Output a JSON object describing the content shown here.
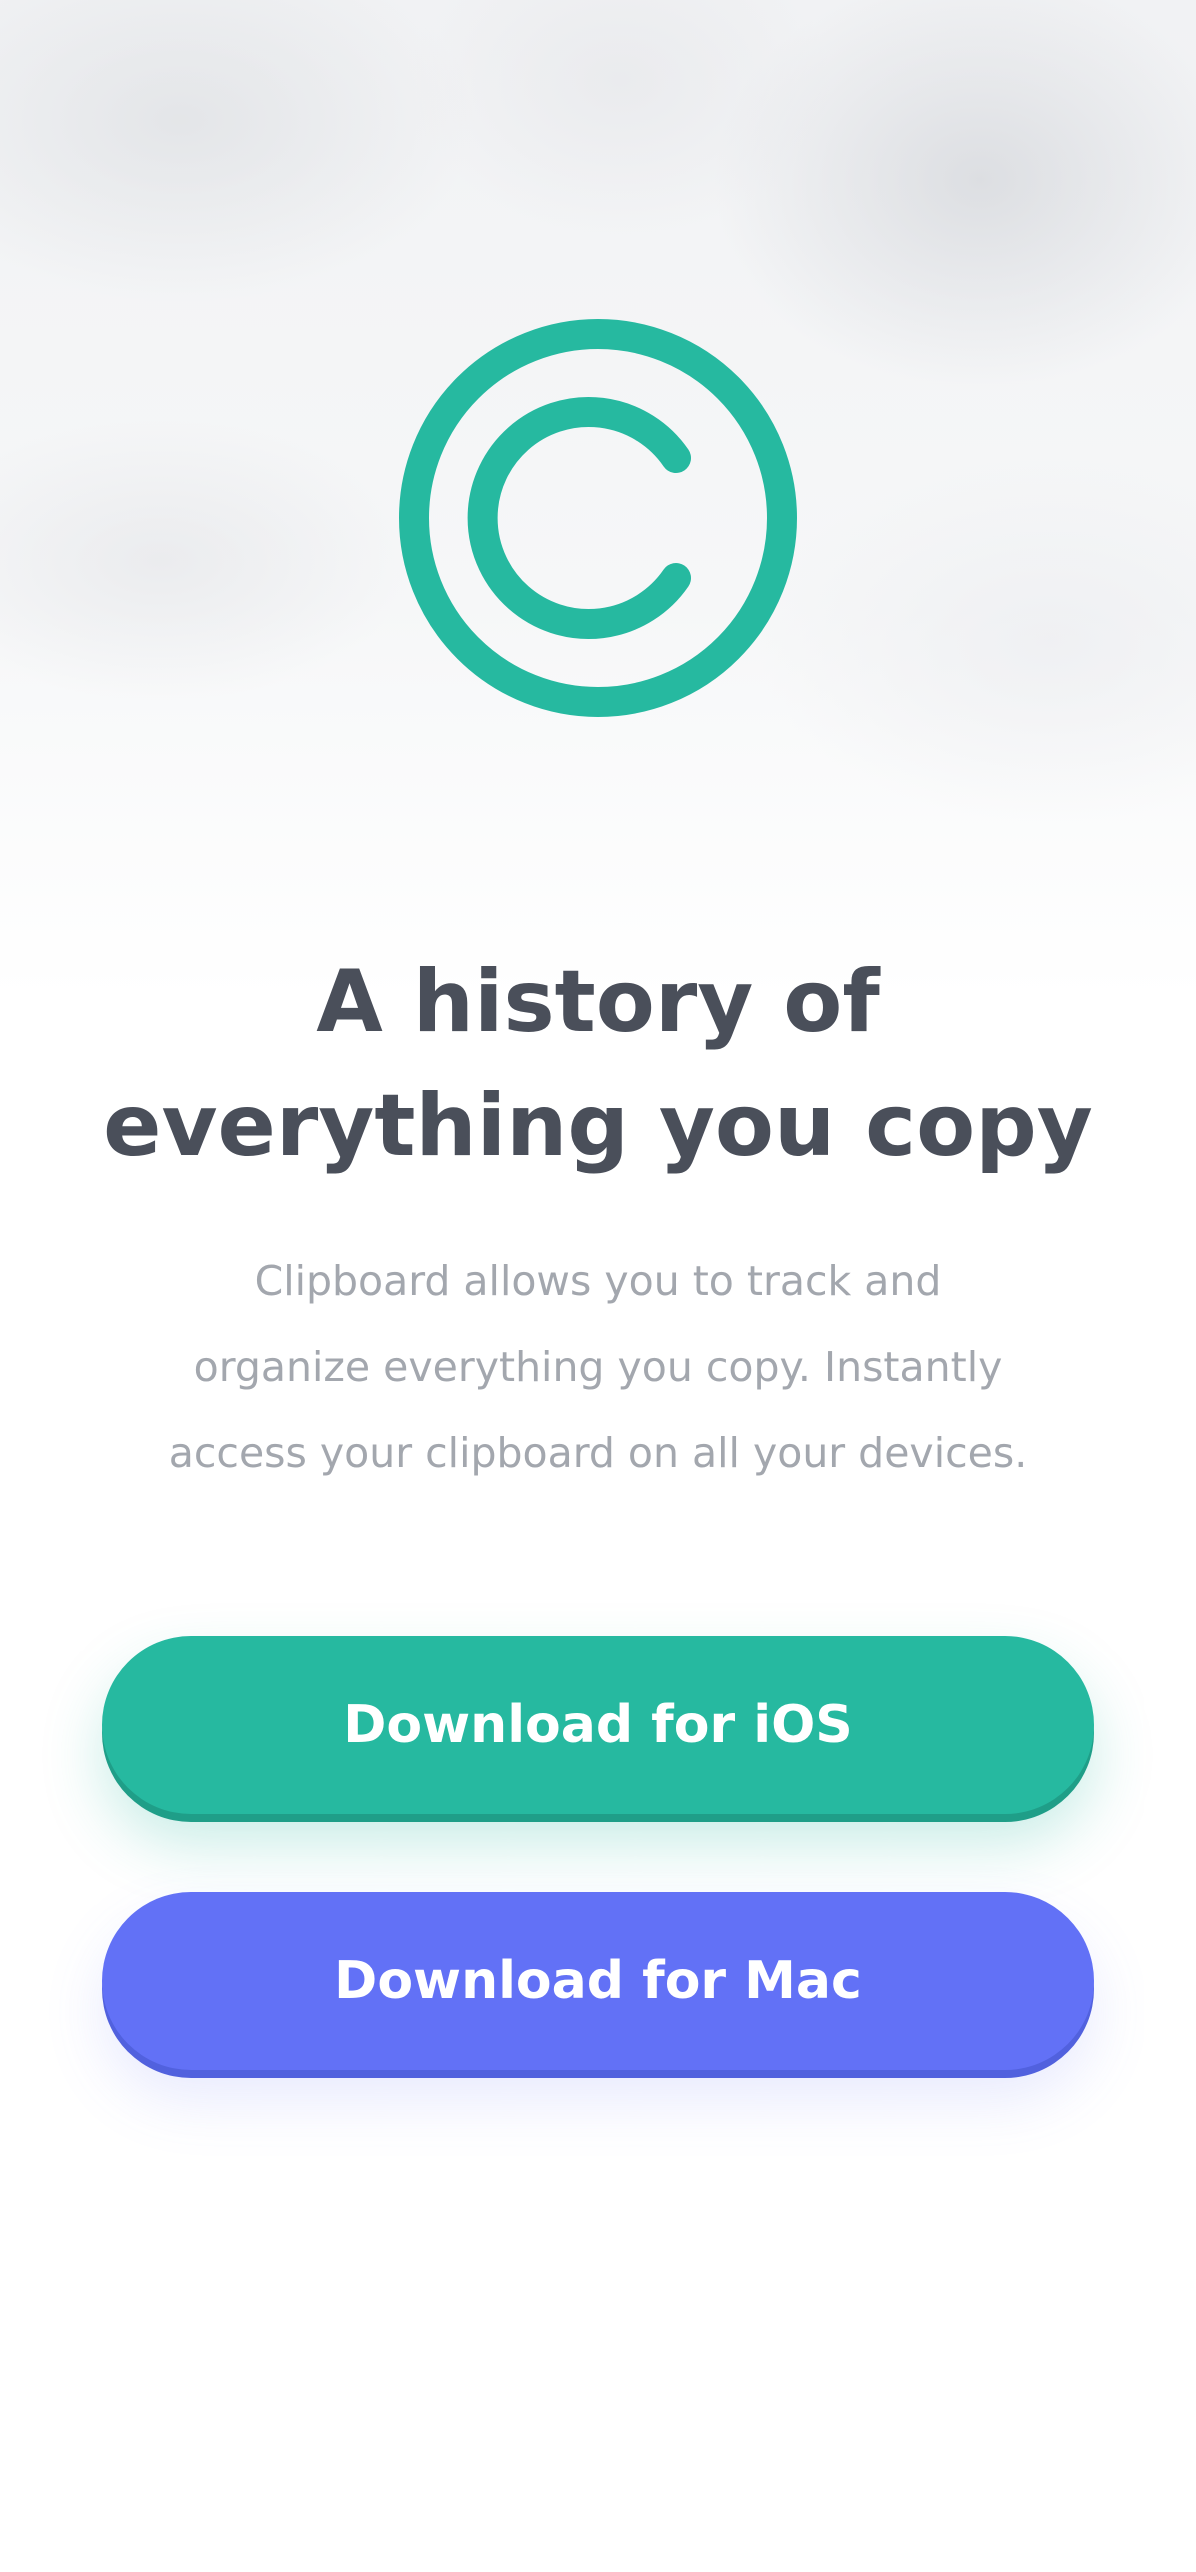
{
  "hero": {
    "logo_icon": "copyright-style-c-icon",
    "accent_color": "#26b9a0",
    "headline_line1": "A history of",
    "headline_line2": "everything you copy",
    "description_line1": "Clipboard allows you to track and",
    "description_line2": "organize everything you copy. Instantly",
    "description_line3": "access your clipboard on all your devices."
  },
  "actions": {
    "ios_label": "Download for iOS",
    "ios_color": "#26b9a0",
    "mac_label": "Download for Mac",
    "mac_color": "#6271f6"
  }
}
